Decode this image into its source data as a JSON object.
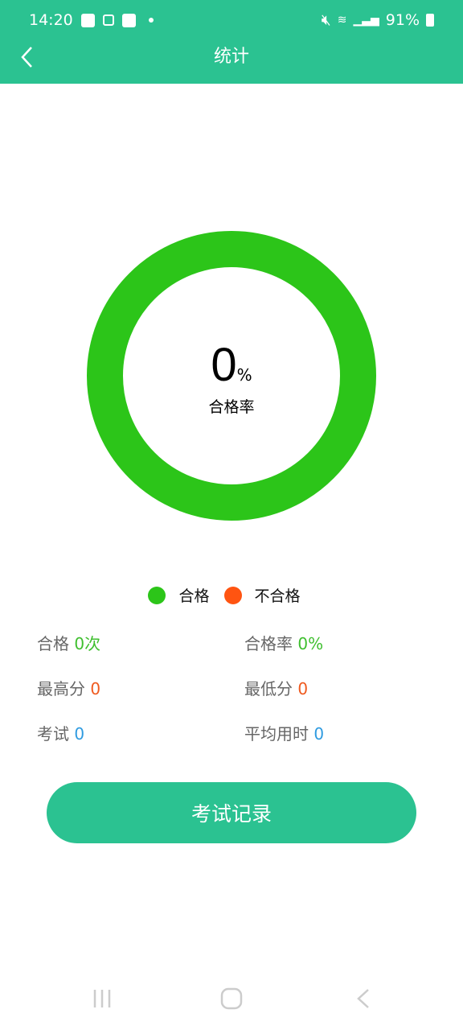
{
  "status_bar": {
    "time": "14:20",
    "battery": "91%"
  },
  "header": {
    "title": "统计",
    "back_icon": "chevron-left-icon"
  },
  "chart_data": {
    "type": "pie",
    "style": "donut",
    "center_value": "0",
    "center_unit": "%",
    "center_label": "合格率",
    "slices": [
      {
        "name": "合格",
        "color": "#2cc519"
      },
      {
        "name": "不合格",
        "color": "#ff5411"
      }
    ]
  },
  "legend": [
    {
      "label": "合格",
      "color": "#2cc519"
    },
    {
      "label": "不合格",
      "color": "#ff5411"
    }
  ],
  "stats": [
    {
      "label": "合格",
      "value": "0次",
      "color": "#3fbf2f"
    },
    {
      "label": "合格率",
      "value": "0%",
      "color": "#3fbf2f"
    },
    {
      "label": "最高分",
      "value": "0",
      "color": "#ef5a1f"
    },
    {
      "label": "最低分",
      "value": "0",
      "color": "#ef5a1f"
    },
    {
      "label": "考试",
      "value": "0",
      "color": "#2f9be0"
    },
    {
      "label": "平均用时",
      "value": "0",
      "color": "#2f9be0"
    }
  ],
  "button": {
    "label": "考试记录"
  }
}
